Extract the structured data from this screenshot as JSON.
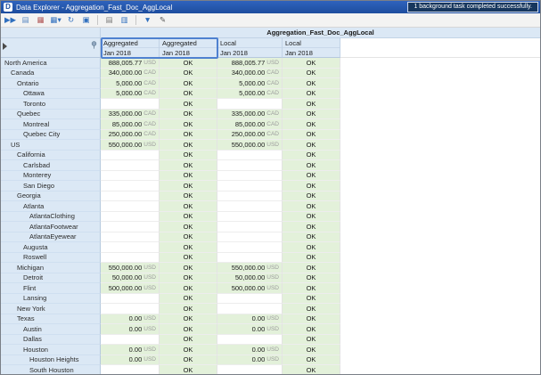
{
  "window": {
    "title": "Data Explorer - Aggregation_Fast_Doc_AggLocal",
    "notification": "1 background task completed successfully.",
    "app_icon_glyph": "D"
  },
  "toolbar": {
    "buttons": [
      {
        "name": "run",
        "glyph": "▶▶",
        "color": "#2f6fbe"
      },
      {
        "name": "export",
        "glyph": "▤",
        "color": "#5b8ac2"
      },
      {
        "name": "delete",
        "glyph": "▦",
        "color": "#b05555"
      },
      {
        "name": "view-selector",
        "glyph": "▦▾",
        "color": "#2f6fbe"
      },
      {
        "name": "refresh",
        "glyph": "↻",
        "color": "#2f6fbe"
      },
      {
        "name": "save",
        "glyph": "▣",
        "color": "#2f6fbe"
      },
      {
        "sep": true
      },
      {
        "name": "new-report",
        "glyph": "▤",
        "color": "#7a7a7a"
      },
      {
        "name": "open-report",
        "glyph": "▥",
        "color": "#2f6fbe"
      },
      {
        "sep": true
      },
      {
        "name": "filter",
        "glyph": "▼",
        "color": "#2f6fbe"
      },
      {
        "name": "edit",
        "glyph": "✎",
        "color": "#555555"
      }
    ]
  },
  "grid": {
    "merged_title": "Aggregation_Fast_Doc_AggLocal",
    "columns": [
      {
        "group": "Aggregated",
        "period": "Jan 2018",
        "selected": true
      },
      {
        "group": "Aggregated",
        "period": "Jan 2018",
        "selected": true
      },
      {
        "group": "Local",
        "period": "Jan 2018",
        "selected": false
      },
      {
        "group": "Local",
        "period": "Jan 2018",
        "selected": false
      }
    ],
    "rows": [
      {
        "label": "North America",
        "indent": 0,
        "cells": [
          [
            "888,005.77",
            "USD"
          ],
          [
            "OK"
          ],
          [
            "888,005.77",
            "USD"
          ],
          [
            "OK"
          ]
        ]
      },
      {
        "label": "Canada",
        "indent": 1,
        "cells": [
          [
            "340,000.00",
            "CAD"
          ],
          [
            "OK"
          ],
          [
            "340,000.00",
            "CAD"
          ],
          [
            "OK"
          ]
        ]
      },
      {
        "label": "Ontario",
        "indent": 2,
        "cells": [
          [
            "5,000.00",
            "CAD"
          ],
          [
            "OK"
          ],
          [
            "5,000.00",
            "CAD"
          ],
          [
            "OK"
          ]
        ]
      },
      {
        "label": "Ottawa",
        "indent": 3,
        "cells": [
          [
            "5,000.00",
            "CAD"
          ],
          [
            "OK"
          ],
          [
            "5,000.00",
            "CAD"
          ],
          [
            "OK"
          ]
        ]
      },
      {
        "label": "Toronto",
        "indent": 3,
        "cells": [
          [],
          [
            "OK"
          ],
          [],
          [
            "OK"
          ]
        ]
      },
      {
        "label": "Quebec",
        "indent": 2,
        "cells": [
          [
            "335,000.00",
            "CAD"
          ],
          [
            "OK"
          ],
          [
            "335,000.00",
            "CAD"
          ],
          [
            "OK"
          ]
        ]
      },
      {
        "label": "Montreal",
        "indent": 3,
        "cells": [
          [
            "85,000.00",
            "CAD"
          ],
          [
            "OK"
          ],
          [
            "85,000.00",
            "CAD"
          ],
          [
            "OK"
          ]
        ]
      },
      {
        "label": "Quebec City",
        "indent": 3,
        "cells": [
          [
            "250,000.00",
            "CAD"
          ],
          [
            "OK"
          ],
          [
            "250,000.00",
            "CAD"
          ],
          [
            "OK"
          ]
        ]
      },
      {
        "label": "US",
        "indent": 1,
        "cells": [
          [
            "550,000.00",
            "USD"
          ],
          [
            "OK"
          ],
          [
            "550,000.00",
            "USD"
          ],
          [
            "OK"
          ]
        ]
      },
      {
        "label": "California",
        "indent": 2,
        "cells": [
          [],
          [
            "OK"
          ],
          [],
          [
            "OK"
          ]
        ]
      },
      {
        "label": "Carlsbad",
        "indent": 3,
        "cells": [
          [],
          [
            "OK"
          ],
          [],
          [
            "OK"
          ]
        ]
      },
      {
        "label": "Monterey",
        "indent": 3,
        "cells": [
          [],
          [
            "OK"
          ],
          [],
          [
            "OK"
          ]
        ]
      },
      {
        "label": "San Diego",
        "indent": 3,
        "cells": [
          [],
          [
            "OK"
          ],
          [],
          [
            "OK"
          ]
        ]
      },
      {
        "label": "Georgia",
        "indent": 2,
        "cells": [
          [],
          [
            "OK"
          ],
          [],
          [
            "OK"
          ]
        ]
      },
      {
        "label": "Atlanta",
        "indent": 3,
        "cells": [
          [],
          [
            "OK"
          ],
          [],
          [
            "OK"
          ]
        ]
      },
      {
        "label": "AtlantaClothing",
        "indent": 4,
        "cells": [
          [],
          [
            "OK"
          ],
          [],
          [
            "OK"
          ]
        ]
      },
      {
        "label": "AtlantaFootwear",
        "indent": 4,
        "cells": [
          [],
          [
            "OK"
          ],
          [],
          [
            "OK"
          ]
        ]
      },
      {
        "label": "AtlantaEyewear",
        "indent": 4,
        "cells": [
          [],
          [
            "OK"
          ],
          [],
          [
            "OK"
          ]
        ]
      },
      {
        "label": "Augusta",
        "indent": 3,
        "cells": [
          [],
          [
            "OK"
          ],
          [],
          [
            "OK"
          ]
        ]
      },
      {
        "label": "Roswell",
        "indent": 3,
        "cells": [
          [],
          [
            "OK"
          ],
          [],
          [
            "OK"
          ]
        ]
      },
      {
        "label": "Michigan",
        "indent": 2,
        "cells": [
          [
            "550,000.00",
            "USD"
          ],
          [
            "OK"
          ],
          [
            "550,000.00",
            "USD"
          ],
          [
            "OK"
          ]
        ]
      },
      {
        "label": "Detroit",
        "indent": 3,
        "cells": [
          [
            "50,000.00",
            "USD"
          ],
          [
            "OK"
          ],
          [
            "50,000.00",
            "USD"
          ],
          [
            "OK"
          ]
        ]
      },
      {
        "label": "Flint",
        "indent": 3,
        "cells": [
          [
            "500,000.00",
            "USD"
          ],
          [
            "OK"
          ],
          [
            "500,000.00",
            "USD"
          ],
          [
            "OK"
          ]
        ]
      },
      {
        "label": "Lansing",
        "indent": 3,
        "cells": [
          [],
          [
            "OK"
          ],
          [],
          [
            "OK"
          ]
        ]
      },
      {
        "label": "New York",
        "indent": 2,
        "cells": [
          [],
          [
            "OK"
          ],
          [],
          [
            "OK"
          ]
        ]
      },
      {
        "label": "Texas",
        "indent": 2,
        "cells": [
          [
            "0.00",
            "USD"
          ],
          [
            "OK"
          ],
          [
            "0.00",
            "USD"
          ],
          [
            "OK"
          ]
        ]
      },
      {
        "label": "Austin",
        "indent": 3,
        "cells": [
          [
            "0.00",
            "USD"
          ],
          [
            "OK"
          ],
          [
            "0.00",
            "USD"
          ],
          [
            "OK"
          ]
        ]
      },
      {
        "label": "Dallas",
        "indent": 3,
        "cells": [
          [],
          [
            "OK"
          ],
          [],
          [
            "OK"
          ]
        ]
      },
      {
        "label": "Houston",
        "indent": 3,
        "cells": [
          [
            "0.00",
            "USD"
          ],
          [
            "OK"
          ],
          [
            "0.00",
            "USD"
          ],
          [
            "OK"
          ]
        ]
      },
      {
        "label": "Houston Heights",
        "indent": 4,
        "cells": [
          [
            "0.00",
            "USD"
          ],
          [
            "OK"
          ],
          [
            "0.00",
            "USD"
          ],
          [
            "OK"
          ]
        ]
      },
      {
        "label": "South Houston",
        "indent": 4,
        "cells": [
          [],
          [
            "OK"
          ],
          [],
          [
            "OK"
          ]
        ]
      }
    ]
  }
}
